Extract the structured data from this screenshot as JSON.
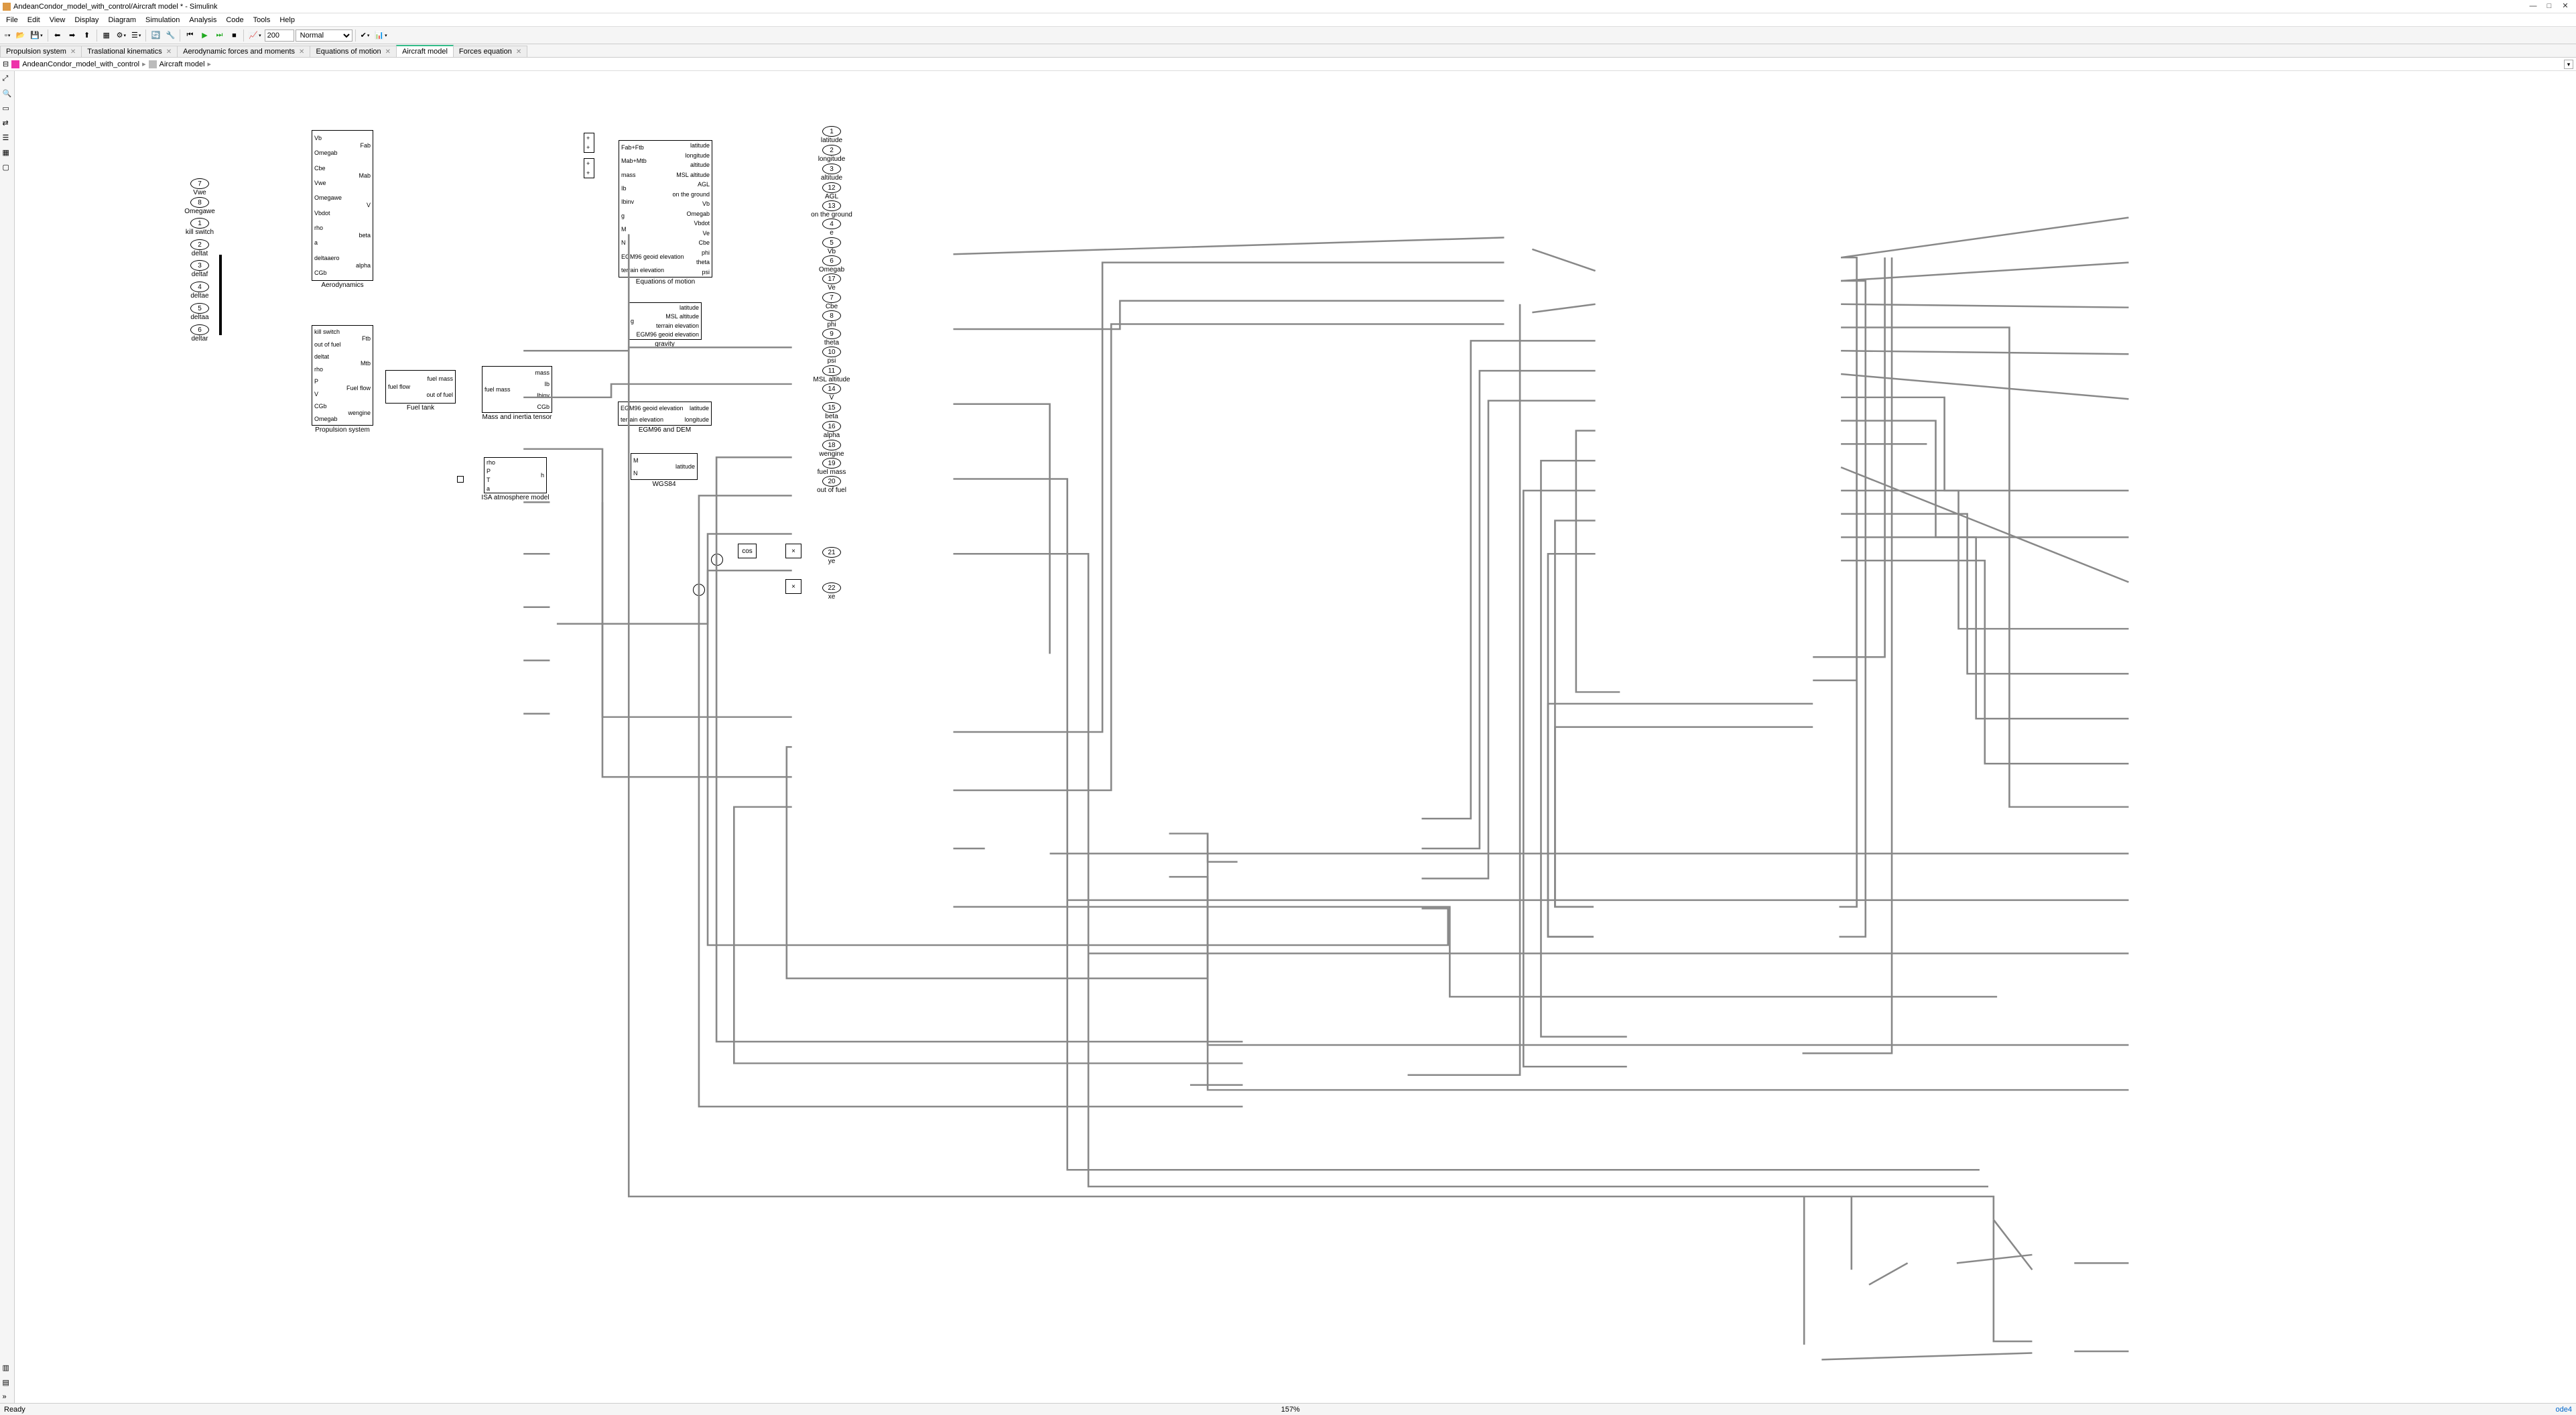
{
  "window": {
    "title": "AndeanCondor_model_with_control/Aircraft model * - Simulink",
    "min": "—",
    "max": "□",
    "close": "✕"
  },
  "menus": [
    "File",
    "Edit",
    "View",
    "Display",
    "Diagram",
    "Simulation",
    "Analysis",
    "Code",
    "Tools",
    "Help"
  ],
  "toolbar": {
    "stoptime": "200",
    "mode": "Normal"
  },
  "tabs": [
    {
      "label": "Propulsion system",
      "active": false
    },
    {
      "label": "Traslational kinematics",
      "active": false
    },
    {
      "label": "Aerodynamic forces and moments",
      "active": false
    },
    {
      "label": "Equations of motion",
      "active": false
    },
    {
      "label": "Aircraft model",
      "active": true
    },
    {
      "label": "Forces equation",
      "active": false
    }
  ],
  "breadcrumb": {
    "root": "AndeanCondor_model_with_control",
    "current": "Aircraft model"
  },
  "inports": [
    {
      "n": "7",
      "label": "Vwe"
    },
    {
      "n": "8",
      "label": "Omegawe"
    },
    {
      "n": "1",
      "label": "kill switch"
    },
    {
      "n": "2",
      "label": "deltat"
    },
    {
      "n": "3",
      "label": "deltaf"
    },
    {
      "n": "4",
      "label": "deltae"
    },
    {
      "n": "5",
      "label": "deltaa"
    },
    {
      "n": "6",
      "label": "deltar"
    }
  ],
  "outports": [
    {
      "n": "1",
      "label": "latitude"
    },
    {
      "n": "2",
      "label": "longitude"
    },
    {
      "n": "3",
      "label": "altitude"
    },
    {
      "n": "12",
      "label": "AGL"
    },
    {
      "n": "13",
      "label": "on the ground"
    },
    {
      "n": "4",
      "label": "e"
    },
    {
      "n": "5",
      "label": "Vb"
    },
    {
      "n": "6",
      "label": "Omegab"
    },
    {
      "n": "17",
      "label": "Ve"
    },
    {
      "n": "7",
      "label": "Cbe"
    },
    {
      "n": "8",
      "label": "phi"
    },
    {
      "n": "9",
      "label": "theta"
    },
    {
      "n": "10",
      "label": "psi"
    },
    {
      "n": "11",
      "label": "MSL altitude"
    },
    {
      "n": "14",
      "label": "V"
    },
    {
      "n": "15",
      "label": "beta"
    },
    {
      "n": "16",
      "label": "alpha"
    },
    {
      "n": "18",
      "label": "wengine"
    },
    {
      "n": "19",
      "label": "fuel mass"
    },
    {
      "n": "20",
      "label": "out of fuel"
    },
    {
      "n": "21",
      "label": "ye"
    },
    {
      "n": "22",
      "label": "xe"
    }
  ],
  "blocks": {
    "aero": {
      "label": "Aerodynamics",
      "in": [
        "Vb",
        "Omegab",
        "Cbe",
        "Vwe",
        "Omegawe",
        "Vbdot",
        "rho",
        "a",
        "deltaaero",
        "CGb"
      ],
      "out": [
        "Fab",
        "Mab",
        "V",
        "beta",
        "alpha"
      ]
    },
    "prop": {
      "label": "Propulsion system",
      "in": [
        "kill switch",
        "out of fuel",
        "deltat",
        "rho",
        "P",
        "V",
        "CGb",
        "Omegab"
      ],
      "out": [
        "Ftb",
        "Mtb",
        "Fuel flow",
        "wengine"
      ]
    },
    "fuel": {
      "label": "Fuel tank",
      "in": [
        "fuel flow"
      ],
      "out": [
        "fuel mass",
        "out of fuel"
      ]
    },
    "mass": {
      "label": "Mass and inertia tensor",
      "in": [
        "fuel mass"
      ],
      "out": [
        "mass",
        "Ib",
        "Ibinv",
        "CGb"
      ]
    },
    "eom": {
      "label": "Equations of motion",
      "in": [
        "Fab+Ftb",
        "Mab+Mtb",
        "mass",
        "Ib",
        "Ibinv",
        "g",
        "M",
        "N",
        "EGM96 geoid elevation",
        "terrain elevation"
      ],
      "out": [
        "latitude",
        "longitude",
        "altitude",
        "MSL altitude",
        "AGL",
        "on the ground",
        "Vb",
        "Omegab",
        "Vbdot",
        "Ve",
        "Cbe",
        "phi",
        "theta",
        "psi"
      ]
    },
    "grav": {
      "label": "gravity",
      "in": [
        "latitude",
        "MSL altitude",
        "terrain elevation",
        "EGM96 geoid elevation"
      ],
      "out": [
        "g"
      ]
    },
    "egm": {
      "label": "EGM96 and DEM",
      "in": [
        "latitude",
        "longitude"
      ],
      "out": [
        "EGM96 geoid elevation",
        "terrain elevation"
      ]
    },
    "wgs": {
      "label": "WGS84",
      "in": [
        "latitude"
      ],
      "out": [
        "M",
        "N"
      ]
    },
    "isa": {
      "label": "ISA atmosphere model",
      "in": [
        "h"
      ],
      "out": [
        "rho",
        "P",
        "T",
        "a"
      ]
    },
    "cos": {
      "label": "cos"
    }
  },
  "sum_ports": {
    "p1": "+",
    "p2": "+",
    "m": "-"
  },
  "status": {
    "left": "Ready",
    "center": "157%",
    "right": "ode4"
  }
}
